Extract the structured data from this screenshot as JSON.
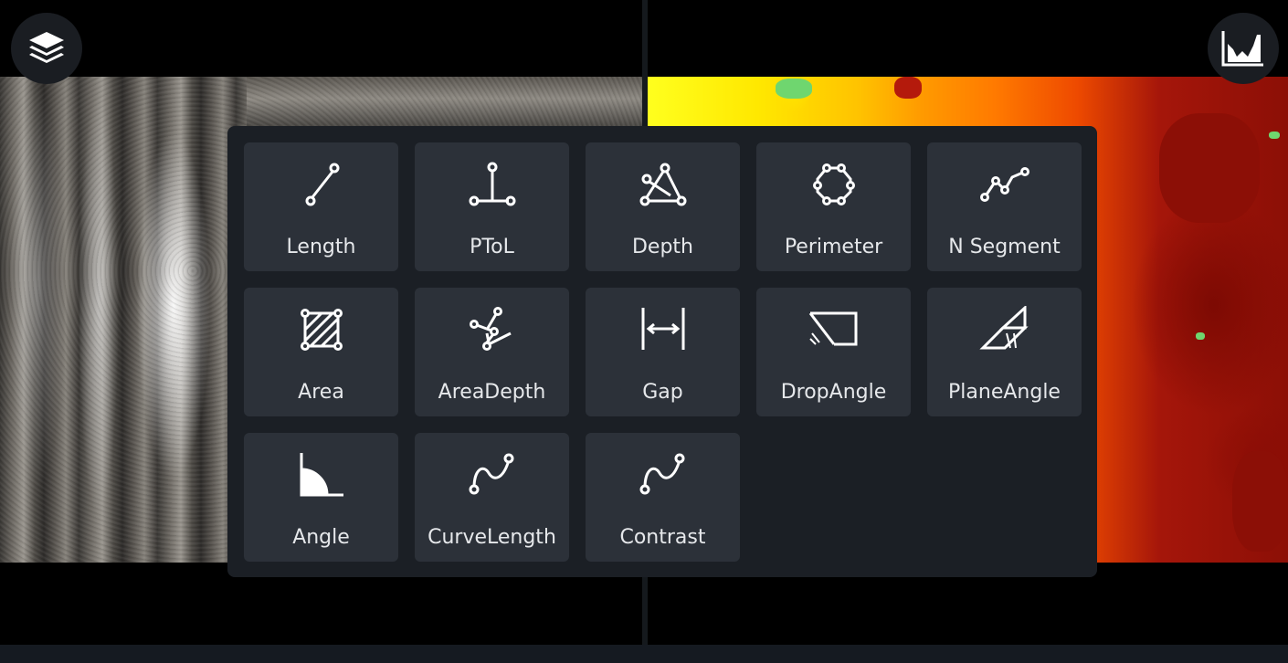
{
  "toolbar": {
    "layers_icon": "layers-icon",
    "histogram_icon": "histogram-icon"
  },
  "measure_menu": {
    "items": [
      {
        "label": "Length",
        "icon": "length-icon"
      },
      {
        "label": "PToL",
        "icon": "point-to-line-icon"
      },
      {
        "label": "Depth",
        "icon": "depth-icon"
      },
      {
        "label": "Perimeter",
        "icon": "perimeter-icon"
      },
      {
        "label": "N Segment",
        "icon": "n-segment-icon"
      },
      {
        "label": "Area",
        "icon": "area-icon"
      },
      {
        "label": "AreaDepth",
        "icon": "area-depth-icon"
      },
      {
        "label": "Gap",
        "icon": "gap-icon"
      },
      {
        "label": "DropAngle",
        "icon": "drop-angle-icon"
      },
      {
        "label": "PlaneAngle",
        "icon": "plane-angle-icon"
      },
      {
        "label": "Angle",
        "icon": "angle-icon"
      },
      {
        "label": "CurveLength",
        "icon": "curve-length-icon"
      },
      {
        "label": "Contrast",
        "icon": "contrast-icon"
      }
    ]
  },
  "colors": {
    "panel_bg": "#1b1f25",
    "tile_bg": "#2c3139",
    "label_color": "#e6e8eb",
    "depth_near": "#ffff1e",
    "depth_far": "#8c0f06"
  }
}
